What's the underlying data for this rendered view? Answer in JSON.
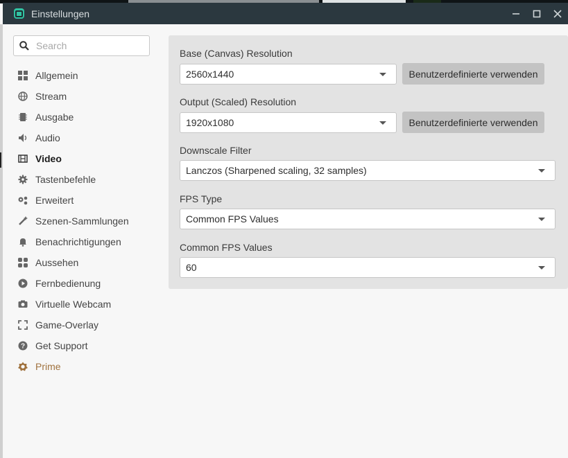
{
  "window": {
    "title": "Einstellungen",
    "controls": [
      "minimize",
      "maximize",
      "close"
    ]
  },
  "search": {
    "placeholder": "Search",
    "value": ""
  },
  "sidebar": {
    "items": [
      {
        "label": "Allgemein",
        "icon": "grid-icon"
      },
      {
        "label": "Stream",
        "icon": "globe-icon"
      },
      {
        "label": "Ausgabe",
        "icon": "chip-icon"
      },
      {
        "label": "Audio",
        "icon": "speaker-icon"
      },
      {
        "label": "Video",
        "icon": "film-icon",
        "active": true
      },
      {
        "label": "Tastenbefehle",
        "icon": "gear-icon"
      },
      {
        "label": "Erweitert",
        "icon": "gears-icon"
      },
      {
        "label": "Szenen-Sammlungen",
        "icon": "wand-icon"
      },
      {
        "label": "Benachrichtigungen",
        "icon": "bell-icon"
      },
      {
        "label": "Aussehen",
        "icon": "apps-icon"
      },
      {
        "label": "Fernbedienung",
        "icon": "play-circle-icon"
      },
      {
        "label": "Virtuelle Webcam",
        "icon": "camera-icon"
      },
      {
        "label": "Game-Overlay",
        "icon": "expand-icon"
      },
      {
        "label": "Get Support",
        "icon": "help-circle-icon"
      },
      {
        "label": "Prime",
        "icon": "prime-icon",
        "accent": "#a0723e"
      }
    ]
  },
  "video": {
    "base_resolution": {
      "label": "Base (Canvas) Resolution",
      "value": "2560x1440",
      "button": "Benutzerdefinierte verwenden"
    },
    "output_resolution": {
      "label": "Output (Scaled) Resolution",
      "value": "1920x1080",
      "button": "Benutzerdefinierte verwenden"
    },
    "downscale_filter": {
      "label": "Downscale Filter",
      "value": "Lanczos (Sharpened scaling, 32 samples)"
    },
    "fps_type": {
      "label": "FPS Type",
      "value": "Common FPS Values"
    },
    "common_fps": {
      "label": "Common FPS Values",
      "value": "60"
    }
  },
  "colors": {
    "titlebar": "#2b383f",
    "accent": "#31c3a2",
    "prime": "#a0723e",
    "panel": "#e3e3e3"
  }
}
